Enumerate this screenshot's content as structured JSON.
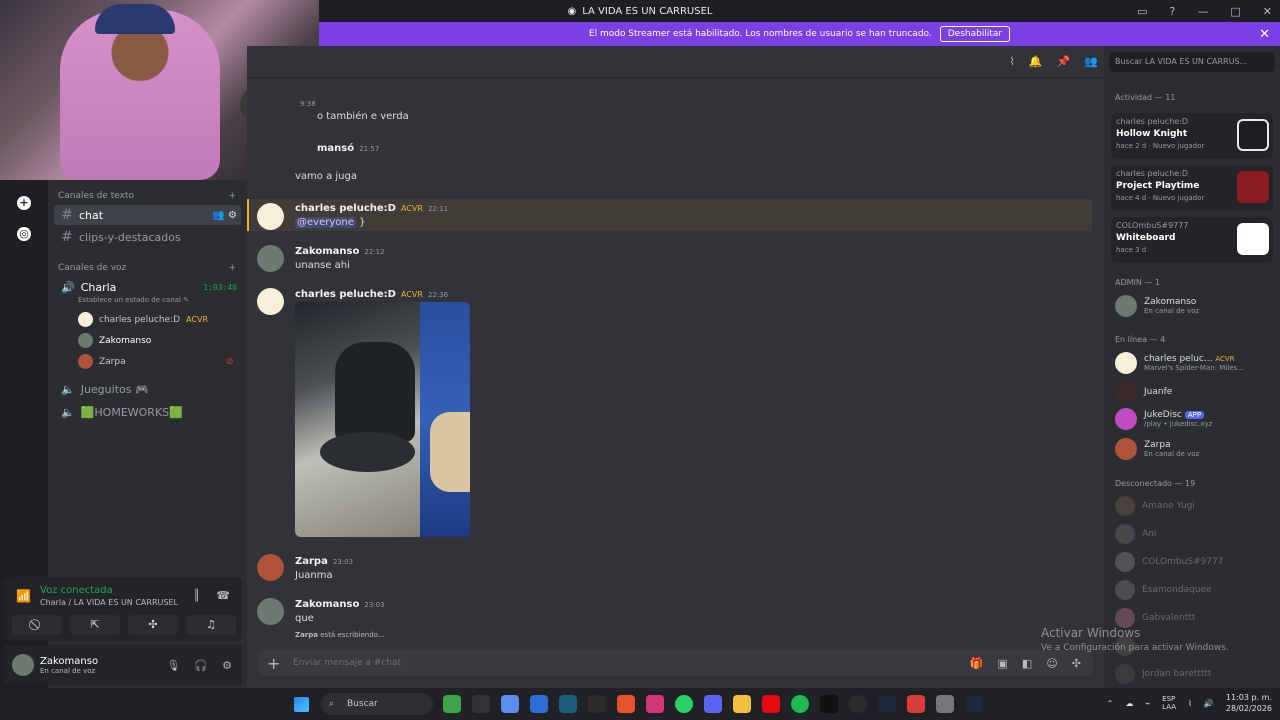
{
  "window": {
    "title": "LA VIDA ES UN CARRUSEL"
  },
  "streamer": {
    "message": "El modo Streamer está habilitado. Los nombres de usuario se han truncado.",
    "button": "Deshabilitar"
  },
  "sidebar": {
    "text_category": "Canales de texto",
    "voice_category": "Canales de voz",
    "channels": [
      {
        "name": "chat"
      },
      {
        "name": "clips-y-destacados"
      }
    ],
    "voice": {
      "name": "Charla",
      "timer": "1:03:40",
      "status_hint": "Establece un estado de canal"
    },
    "voice_users": [
      {
        "name": "charles peluche:D",
        "tag": "ACVR"
      },
      {
        "name": "Zakomanso"
      },
      {
        "name": "Zarpa"
      }
    ],
    "other_voice": [
      "Jueguitos 🎮",
      "🟩HOMEWORKS🟩"
    ]
  },
  "voice_panel": {
    "state": "Voz conectada",
    "sub": "Charla / LA VIDA ES UN CARRUSEL"
  },
  "user_panel": {
    "name": "Zakomanso",
    "status": "En canal de voz"
  },
  "messages": [
    {
      "author": "",
      "time": "9:38",
      "text": "o también e verda"
    },
    {
      "author": "mansó",
      "time": "21:57",
      "text": "vamo a juga"
    },
    {
      "author": "charles peluche:D",
      "tag": "ACVR",
      "time": "22:11",
      "mention": "@everyone",
      "text": "}"
    },
    {
      "author": "Zakomanso",
      "time": "22:12",
      "text": "unanse ahi"
    },
    {
      "author": "charles peluche:D",
      "tag": "ACVR",
      "time": "22:36",
      "text": ""
    },
    {
      "author": "Zarpa",
      "time": "23:03",
      "text": "Juanma"
    },
    {
      "author": "Zakomanso",
      "time": "23:03",
      "text": "que"
    }
  ],
  "typing": {
    "user": "Zarpa",
    "text": "está escribiendo..."
  },
  "composer": {
    "placeholder": "Enviar mensaje a #chat"
  },
  "right": {
    "search_placeholder": "Buscar LA VIDA ES UN CARRUS...",
    "activity_header": "Actividad — 11",
    "activities": [
      {
        "user": "charles peluche:D",
        "game": "Hollow Knight",
        "meta": "hace 2 d · Nuevo jugador"
      },
      {
        "user": "charles peluche:D",
        "game": "Project Playtime",
        "meta": "hace 4 d · Nuevo jugador"
      },
      {
        "user": "COLOmbuS#9777",
        "game": "Whiteboard",
        "meta": "hace 3 d"
      }
    ],
    "admin_header": "ADMIN — 1",
    "admin": [
      {
        "name": "Zakomanso",
        "sub": "En canal de voz"
      }
    ],
    "online_header": "En línea — 4",
    "online": [
      {
        "name": "charles peluc...",
        "tag": "ACVR",
        "sub": "Marvel's Spider-Man: Miles..."
      },
      {
        "name": "Juanfe",
        "sub": ""
      },
      {
        "name": "JukeDisc",
        "badge": "APP",
        "sub": "/play • jukedisc.xyz"
      },
      {
        "name": "Zarpa",
        "sub": "En canal de voz"
      }
    ],
    "offline_header": "Desconectado — 19",
    "offline": [
      "Amane Yugi",
      "Ani",
      "COLOmbuS#9777",
      "Esamondaquee",
      "Gabvalenttt",
      "",
      "Jordan barettttt"
    ]
  },
  "watermark": {
    "title": "Activar Windows",
    "sub": "Ve a Configuración para activar Windows."
  },
  "taskbar": {
    "search": "Buscar",
    "lang": "ESP\nLAA",
    "time": "11:03 p. m.",
    "date": "28/02/2026"
  },
  "colors": {
    "accent": "#5865f2",
    "streamer": "#7b3fe4",
    "online": "#23a55a",
    "gold": "#f0b232"
  }
}
